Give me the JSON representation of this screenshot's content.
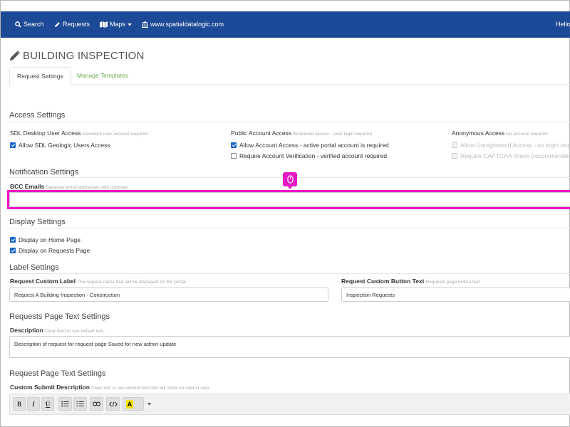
{
  "nav": {
    "search_label": "Search",
    "requests_label": "Requests",
    "maps_label": "Maps",
    "site_label": "www.spatialdatalogic.com",
    "greeting": "Hello",
    "bar_color": "#1d4a96"
  },
  "page": {
    "title": "BUILDING INSPECTION",
    "tabs": [
      {
        "label": "Request Settings",
        "active": true
      },
      {
        "label": "Manage Templates",
        "active": false
      }
    ]
  },
  "access": {
    "heading": "Access Settings",
    "desktop": {
      "label": "SDL Desktop User Access",
      "hint": "Geoclient user account required.",
      "options": [
        {
          "label": "Allow SDL Geologic Users Access",
          "checked": true
        }
      ]
    },
    "public": {
      "label": "Public Account Access",
      "hint": "Restricted access - user login required",
      "options": [
        {
          "label": "Allow Account Access - active portal account is required",
          "checked": true
        },
        {
          "label": "Require Account Verification - verified account required",
          "checked": false
        }
      ]
    },
    "anonymous": {
      "label": "Anonymous Access",
      "hint": "No account required.",
      "options": [
        {
          "label": "Allow Unregistered Access - no login requ",
          "checked": false,
          "disabled": true
        },
        {
          "label": "Require CAPTCHA check (recommended",
          "checked": false,
          "disabled": true
        }
      ]
    }
  },
  "notification": {
    "heading": "Notification Settings",
    "bcc_label": "BCC Emails",
    "bcc_hint": "Separate email addresses with commas",
    "bcc_value": ""
  },
  "display": {
    "heading": "Display Settings",
    "options": [
      {
        "label": "Display on Home Page",
        "checked": true
      },
      {
        "label": "Display on Requests Page",
        "checked": true
      }
    ]
  },
  "labels": {
    "heading": "Label Settings",
    "custom_label": "Request Custom Label",
    "custom_label_hint": "The request name that will be displayed on the portal",
    "custom_label_value": "Request  A Building Inspection - Construction",
    "button_label": "Request Custom Button Text",
    "button_hint": "Requests page button text",
    "button_value": "Inspection Requests"
  },
  "requests_text": {
    "heading": "Requests Page Text Settings",
    "desc_label": "Description",
    "desc_hint": "Clear field to see default text.",
    "desc_value": "Description of request for request page Saved for new admin update"
  },
  "request_text": {
    "heading": "Request Page Text Settings",
    "submit_label": "Custom Submit Description",
    "submit_hint": "Clear text to see default text that will show on submit step"
  },
  "toolbar": {
    "bold": "B",
    "italic": "I",
    "underline": "U",
    "highlight_letter": "A",
    "highlight_color": "#f5e400"
  },
  "accent": {
    "focus_highlight": "#ef0fc9",
    "checkbox": "#1a66c9",
    "link": "#6ab04c"
  }
}
